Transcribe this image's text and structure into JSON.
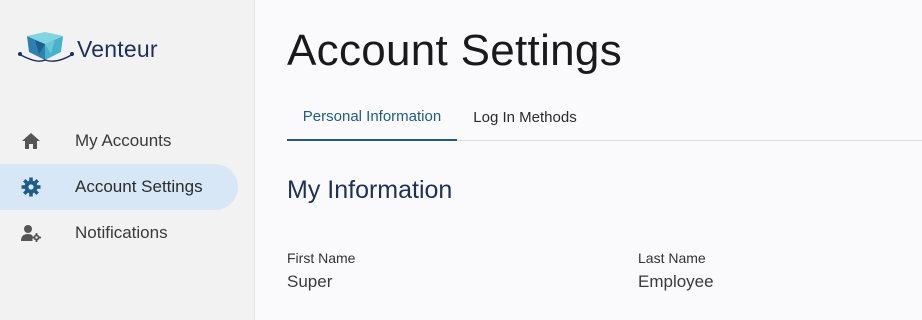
{
  "brand": {
    "name": "Venteur",
    "logo_icon": "venteur-logo-icon",
    "accent": "#1f5c86"
  },
  "sidebar": {
    "items": [
      {
        "label": "My Accounts",
        "icon": "home-icon",
        "active": false
      },
      {
        "label": "Account Settings",
        "icon": "gear-icon",
        "active": true
      },
      {
        "label": "Notifications",
        "icon": "user-gear-icon",
        "active": false
      }
    ]
  },
  "main": {
    "title": "Account Settings",
    "tabs": [
      {
        "label": "Personal Information",
        "active": true
      },
      {
        "label": "Log In Methods",
        "active": false
      }
    ],
    "section_title": "My Information",
    "fields": [
      {
        "label": "First Name",
        "value": "Super"
      },
      {
        "label": "Last Name",
        "value": "Employee"
      }
    ]
  }
}
